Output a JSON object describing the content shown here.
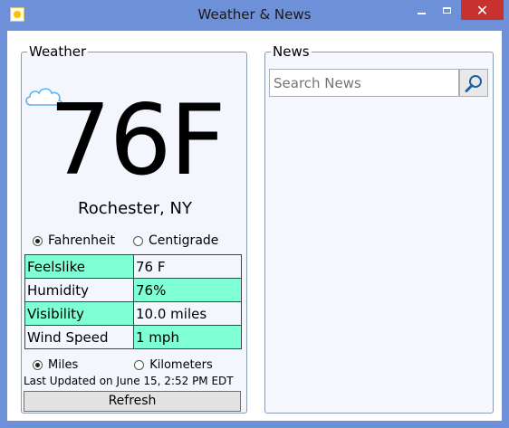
{
  "window": {
    "title": "Weather & News",
    "close_glyph": "✕",
    "icons": {
      "app": "sun-icon",
      "minimize": "minimize-icon",
      "maximize": "maximize-icon",
      "close": "close-icon"
    }
  },
  "weather": {
    "legend": "Weather",
    "condition_icon": "cloud-icon",
    "temperature": "76F",
    "location": "Rochester, NY",
    "units": {
      "fahrenheit_label": "Fahrenheit",
      "centigrade_label": "Centigrade",
      "selected": "Fahrenheit"
    },
    "stats": [
      {
        "label": "Feelslike",
        "value": "76 F"
      },
      {
        "label": "Humidity",
        "value": "76%"
      },
      {
        "label": "Visibility",
        "value": "10.0 miles"
      },
      {
        "label": "Wind Speed",
        "value": "1 mph"
      }
    ],
    "distance_units": {
      "miles_label": "Miles",
      "kilometers_label": "Kilometers",
      "selected": "Miles"
    },
    "last_updated": "Last Updated on June 15, 2:52 PM EDT",
    "refresh_label": "Refresh"
  },
  "news": {
    "legend": "News",
    "search_placeholder": "Search News",
    "search_value": "",
    "search_icon": "search-icon"
  },
  "colors": {
    "titlebar": "#6e90d8",
    "close_button": "#c7312e",
    "stat_highlight": "#7fffd4",
    "panel_background": "#f3f7fd"
  }
}
